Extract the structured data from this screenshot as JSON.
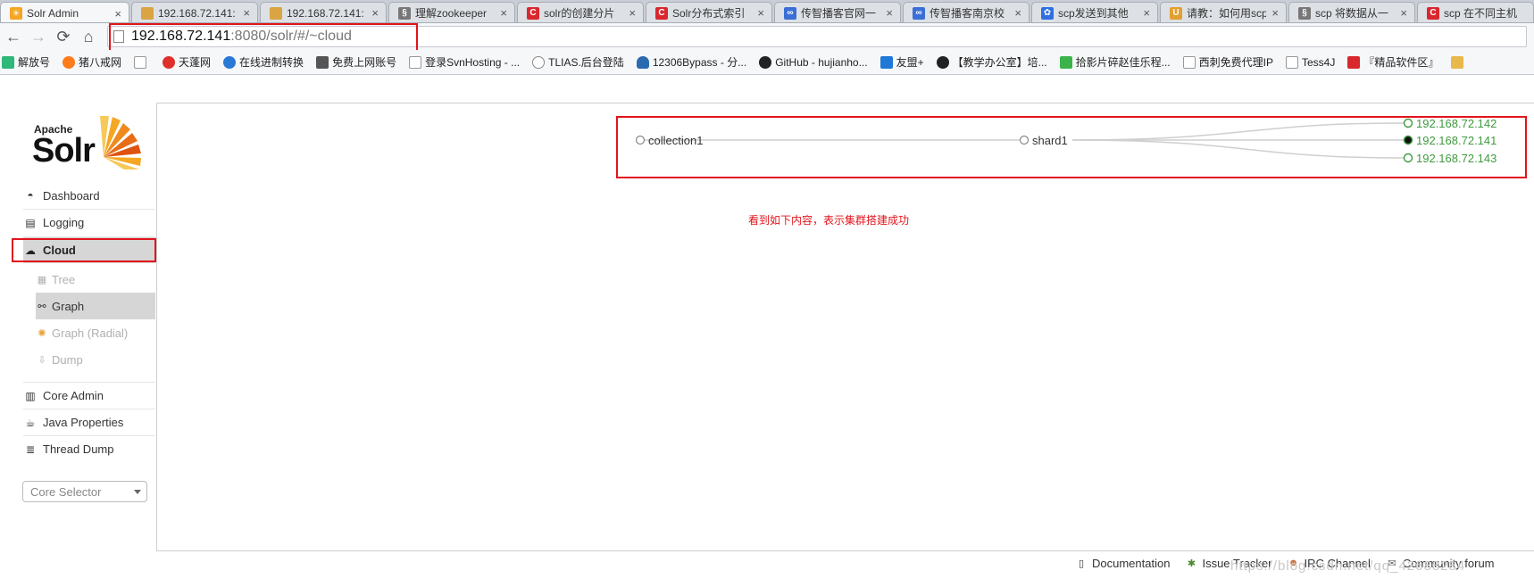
{
  "browser": {
    "tabs": [
      {
        "label": "Solr Admin",
        "icon": "solr-sun-icon",
        "color": "#f5a623",
        "active": true
      },
      {
        "label": "192.168.72.141:",
        "icon": "solr-page-icon",
        "color": "#d9a441",
        "active": false
      },
      {
        "label": "192.168.72.141:",
        "icon": "solr-page-icon",
        "color": "#d9a441",
        "active": false
      },
      {
        "label": "理解zookeeper",
        "icon": "csdn-icon",
        "color": "#777777",
        "active": false
      },
      {
        "label": "solr的创建分片",
        "icon": "csdn-c-icon",
        "color": "#d9272e",
        "active": false
      },
      {
        "label": "Solr分布式索引",
        "icon": "csdn-c-icon",
        "color": "#d9272e",
        "active": false
      },
      {
        "label": "传智播客官网一",
        "icon": "itcast-icon",
        "color": "#3b6fd6",
        "active": false
      },
      {
        "label": "传智播客南京校",
        "icon": "itcast-icon",
        "color": "#3b6fd6",
        "active": false
      },
      {
        "label": "scp发送到其他",
        "icon": "baidu-paw-icon",
        "color": "#2f6fe0",
        "active": false
      },
      {
        "label": "请教：如何用scp",
        "icon": "forum-icon",
        "color": "#e3a030",
        "active": false
      },
      {
        "label": "scp 将数据从一",
        "icon": "csdn-icon",
        "color": "#777777",
        "active": false
      },
      {
        "label": "scp 在不同主机",
        "icon": "csdn-c-icon",
        "color": "#d9272e",
        "active": false
      }
    ],
    "close_glyph": "×",
    "nav": {
      "back": "←",
      "forward": "→",
      "reload": "⟳",
      "home": "⌂"
    },
    "url_host": "192.168.72.141",
    "url_path": ":8080/solr/#/~cloud"
  },
  "bookmarks": [
    {
      "label": "解放号",
      "color": "#2eb87a"
    },
    {
      "label": "猪八戒网",
      "color": "#ff7a1a"
    },
    {
      "label": "",
      "color": "#ffffff"
    },
    {
      "label": "天蓬网",
      "color": "#e0302c"
    },
    {
      "label": "在线进制转换",
      "color": "#2a78d6"
    },
    {
      "label": "免费上网账号",
      "color": "#555555"
    },
    {
      "label": "登录SvnHosting - ...",
      "color": "#ffffff"
    },
    {
      "label": "TLIAS.后台登陆",
      "color": "#888888"
    },
    {
      "label": "12306Bypass - 分...",
      "color": "#2a6bb0"
    },
    {
      "label": "GitHub - hujianho...",
      "color": "#222222"
    },
    {
      "label": "友盟+",
      "color": "#1f78d6"
    },
    {
      "label": "【教学办公室】培...",
      "color": "#222222"
    },
    {
      "label": "拾影片碎赵佳乐程...",
      "color": "#3bb34a"
    },
    {
      "label": "西刺免费代理IP",
      "color": "#ffffff"
    },
    {
      "label": "Tess4J",
      "color": "#ffffff"
    },
    {
      "label": "『精品软件区』",
      "color": "#d9272e"
    },
    {
      "label": "",
      "color": "#e8b84a"
    }
  ],
  "solr": {
    "logo_apache": "Apache",
    "logo_solr": "Solr",
    "menu": [
      {
        "label": "Dashboard",
        "icon": "dashboard-icon",
        "glyph": "◓",
        "active": false
      },
      {
        "label": "Logging",
        "icon": "logging-icon",
        "glyph": "▤",
        "active": false
      },
      {
        "label": "Cloud",
        "icon": "cloud-icon",
        "glyph": "☁",
        "active": true
      }
    ],
    "submenu": [
      {
        "label": "Tree",
        "icon": "tree-icon",
        "glyph": "▦",
        "active": false
      },
      {
        "label": "Graph",
        "icon": "graph-icon",
        "glyph": "⚯",
        "active": true
      },
      {
        "label": "Graph (Radial)",
        "icon": "graph-radial-icon",
        "glyph": "✺",
        "active": false
      },
      {
        "label": "Dump",
        "icon": "dump-icon",
        "glyph": "⇩",
        "active": false
      }
    ],
    "menu2": [
      {
        "label": "Core Admin",
        "icon": "core-admin-icon",
        "glyph": "▥"
      },
      {
        "label": "Java Properties",
        "icon": "java-properties-icon",
        "glyph": "☕"
      },
      {
        "label": "Thread Dump",
        "icon": "thread-dump-icon",
        "glyph": "≣"
      }
    ],
    "core_selector": "Core Selector"
  },
  "cloud_graph": {
    "collection": "collection1",
    "shard": "shard1",
    "replicas": [
      {
        "host": "192.168.72.142",
        "leader": false
      },
      {
        "host": "192.168.72.141",
        "leader": true
      },
      {
        "host": "192.168.72.143",
        "leader": false
      }
    ],
    "active_color": "#3f9a3f"
  },
  "annotation": "看到如下内容，表示集群搭建成功",
  "footer": [
    {
      "label": "Documentation",
      "icon": "documentation-icon",
      "glyph": "▯"
    },
    {
      "label": "Issue Tracker",
      "icon": "bug-icon",
      "glyph": "✱"
    },
    {
      "label": "IRC Channel",
      "icon": "irc-icon",
      "glyph": "☻"
    },
    {
      "label": "Community forum",
      "icon": "mail-icon",
      "glyph": "✉"
    }
  ],
  "watermark": "https://blog.csdn.net/qq_42688284"
}
